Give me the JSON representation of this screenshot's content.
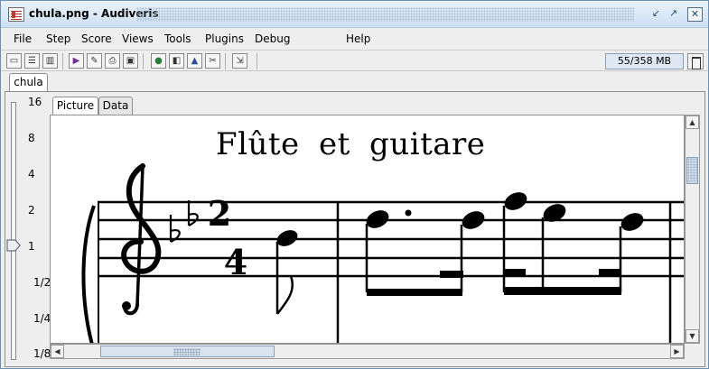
{
  "window": {
    "title": "chula.png - Audiveris",
    "title_buttons": [
      "restore-icon",
      "maximize-icon",
      "close-icon"
    ]
  },
  "menu": {
    "items": [
      "File",
      "Step",
      "Score",
      "Views",
      "Tools",
      "Plugins",
      "Debug",
      "Help"
    ]
  },
  "toolbar": {
    "tools": [
      "open-icon",
      "sheet-icon",
      "columns-icon",
      "play-icon",
      "edit-icon",
      "print-icon",
      "save-icon",
      "binoculars-icon",
      "frame-icon",
      "bell-icon",
      "scissors-icon",
      "export-icon"
    ],
    "memory": "55/358 MB",
    "trash": "trash-icon"
  },
  "tabs": {
    "sheet": "chula",
    "views": [
      "Picture",
      "Data"
    ],
    "active_view": "Picture"
  },
  "zoom": {
    "labels": [
      "16",
      "8",
      "4",
      "2",
      "1",
      "1/2",
      "1/4",
      "1/8"
    ],
    "current": "1"
  },
  "score": {
    "title": "Flûte et guitare"
  },
  "colors": {
    "title_bar": "#cfe0f2",
    "window_border": "#6f8fae",
    "accent": "#d9e3ee"
  }
}
